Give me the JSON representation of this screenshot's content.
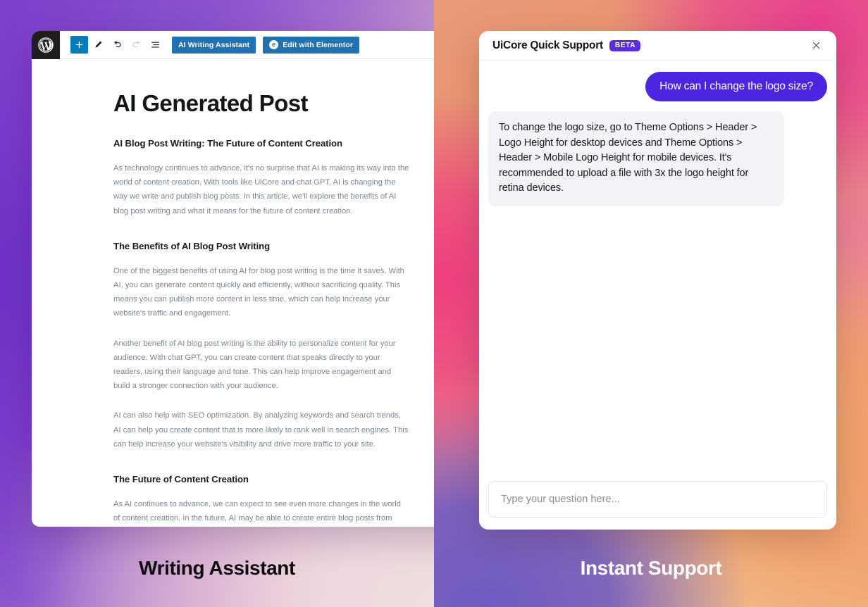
{
  "left_panel": {
    "caption": "Writing Assistant",
    "editor": {
      "logo_icon": "wordpress-logo-icon",
      "tools": [
        {
          "name": "add-block-button",
          "icon": "plus-icon",
          "state": "primary"
        },
        {
          "name": "edit-tool-button",
          "icon": "pencil-icon",
          "state": "normal"
        },
        {
          "name": "undo-button",
          "icon": "undo-arrow-icon",
          "state": "normal"
        },
        {
          "name": "redo-button",
          "icon": "redo-arrow-icon",
          "state": "disabled"
        },
        {
          "name": "document-overview-button",
          "icon": "list-view-icon",
          "state": "normal"
        }
      ],
      "ai_writing_assistant_label": "AI Writing Assistant",
      "elementor_label": "Edit with Elementor",
      "elementor_mark": "e"
    },
    "post": {
      "title": "AI Generated Post",
      "blocks": [
        {
          "type": "h2",
          "text": "AI Blog Post Writing: The Future of Content Creation"
        },
        {
          "type": "p",
          "text": "As technology continues to advance, it's no surprise that AI is making its way into the world of content creation. With tools like UiCore and chat GPT, AI is changing the way we write and publish blog posts. In this article, we'll explore the benefits of AI blog post writing and what it means for the future of content creation."
        },
        {
          "type": "h2",
          "text": "The Benefits of AI Blog Post Writing"
        },
        {
          "type": "p",
          "text": "One of the biggest benefits of using AI for blog post writing is the time it saves. With AI, you can generate content quickly and efficiently, without sacrificing quality. This means you can publish more content in less time, which can help increase your website's traffic and engagement."
        },
        {
          "type": "p",
          "text": "Another benefit of AI blog post writing is the ability to personalize content for your audience. With chat GPT, you can create content that speaks directly to your readers, using their language and tone. This can help improve engagement and build a stronger connection with your audience."
        },
        {
          "type": "p",
          "text": "AI can also help with SEO optimization. By analyzing keywords and search trends, AI can help you create content that is more likely to rank well in search engines. This can help increase your website's visibility and drive more traffic to your site."
        },
        {
          "type": "h2",
          "text": "The Future of Content Creation"
        },
        {
          "type": "p",
          "text": "As AI continues to advance, we can expect to see even more changes in the world of content creation. In the future, AI may be able to create entire blog posts from scratch, without any human input. This could revolutionize the way we think about content creation and open up new possibilities for businesses and individuals alike."
        }
      ]
    }
  },
  "right_panel": {
    "caption": "Instant Support",
    "chat": {
      "title": "UiCore Quick Support",
      "badge": "BETA",
      "close_icon": "close-x-icon",
      "messages": [
        {
          "role": "user",
          "text": "How can I change the logo size?"
        },
        {
          "role": "bot",
          "text": "To change the logo size, go to Theme Options > Header > Logo Height for desktop devices and Theme Options > Header > Mobile Logo Height for mobile devices. It's recommended to upload a file with 3x the logo height for retina devices."
        }
      ],
      "input_value": "",
      "input_placeholder": "Type your question here..."
    }
  },
  "colors": {
    "wp_blue": "#2271b1",
    "wp_add_block_blue": "#007cba",
    "beta_purple": "#5b2de0",
    "user_bubble_purple": "#4b25e0",
    "bot_bubble_grey": "#f1f3f7",
    "post_text_grey": "#7b8794"
  }
}
